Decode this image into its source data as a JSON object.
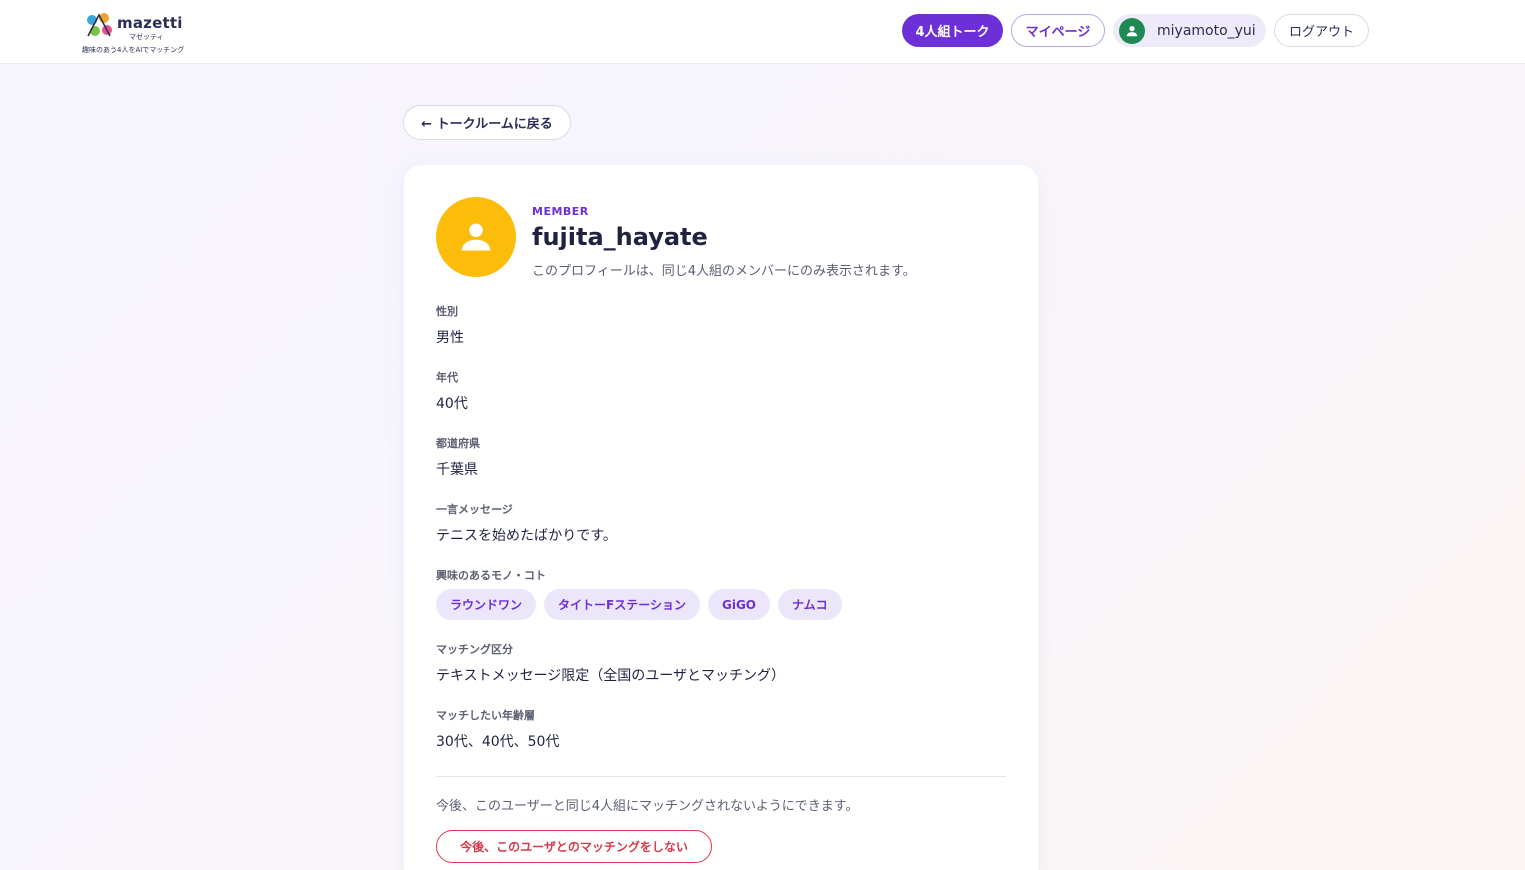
{
  "header": {
    "logo_name": "mazetti",
    "logo_kana": "マゼッティ",
    "logo_tagline": "趣味のあう4人をAIでマッチング",
    "nav": {
      "talk": "4人組トーク",
      "mypage": "マイページ",
      "username": "miyamoto_yui",
      "logout": "ログアウト"
    }
  },
  "back_button": "← トークルームに戻る",
  "profile": {
    "label": "MEMBER",
    "name": "fujita_hayate",
    "note": "このプロフィールは、同じ4人組のメンバーにのみ表示されます。",
    "fields": {
      "gender": {
        "label": "性別",
        "value": "男性"
      },
      "age": {
        "label": "年代",
        "value": "40代"
      },
      "prefecture": {
        "label": "都道府県",
        "value": "千葉県"
      },
      "message": {
        "label": "一言メッセージ",
        "value": "テニスを始めたばかりです。"
      },
      "interests": {
        "label": "興味のあるモノ・コト",
        "tags": [
          "ラウンドワン",
          "タイトーFステーション",
          "GiGO",
          "ナムコ"
        ]
      },
      "matching_type": {
        "label": "マッチング区分",
        "value": "テキストメッセージ限定（全国のユーザとマッチング）"
      },
      "desired_ages": {
        "label": "マッチしたい年齢層",
        "value": "30代、40代、50代"
      }
    },
    "block_note": "今後、このユーザーと同じ4人組にマッチングされないようにできます。",
    "block_button": "今後、このユーザとのマッチングをしない"
  },
  "colors": {
    "accent": "#6d2fd6",
    "avatar_member": "#fbbd0a",
    "avatar_user": "#1e8a53",
    "danger": "#d8394a"
  }
}
